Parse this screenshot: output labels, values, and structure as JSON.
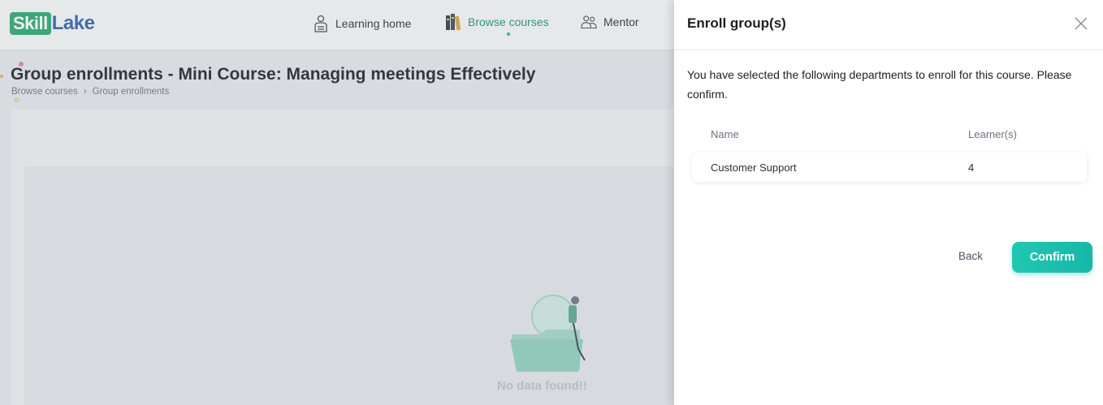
{
  "header": {
    "logo_part1": "Skill",
    "logo_part2": "Lake",
    "nav": [
      {
        "label": "Learning home",
        "icon": "learning-home-icon"
      },
      {
        "label": "Browse courses",
        "icon": "books-icon",
        "active": true
      },
      {
        "label": "Mentor",
        "icon": "mentor-icon"
      }
    ]
  },
  "page": {
    "title": "Group enrollments - Mini Course: Managing meetings Effectively",
    "breadcrumb": [
      "Browse courses",
      "Group enrollments"
    ],
    "breadcrumb_separator": "›",
    "empty_text": "No data found!!"
  },
  "drawer": {
    "title": "Enroll group(s)",
    "description": "You have selected the following departments to enroll for this course. Please confirm.",
    "columns": [
      "Name",
      "Learner(s)"
    ],
    "rows": [
      {
        "name": "Customer Support",
        "learners": "4"
      }
    ],
    "back_label": "Back",
    "confirm_label": "Confirm"
  },
  "colors": {
    "accent": "#1fc8b2",
    "brand_green": "#2aa56e",
    "brand_blue": "#2f5fa8"
  }
}
